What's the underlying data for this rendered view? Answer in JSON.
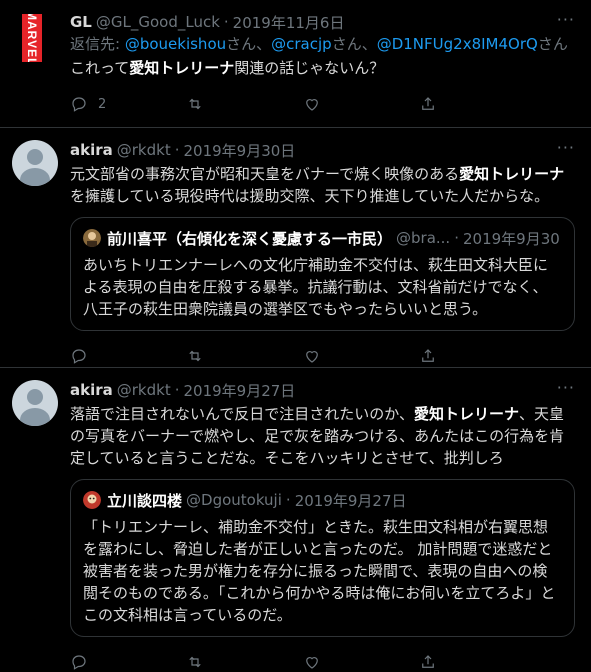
{
  "tweets": [
    {
      "name": "GL",
      "handle": "@GL_Good_Luck",
      "dot": "·",
      "date": "2019年11月6日",
      "avatar_text": "MARVEL",
      "replying_prefix": "返信先: ",
      "replying": [
        {
          "handle": "@bouekishou",
          "suffix": "さん、"
        },
        {
          "handle": "@cracjp",
          "suffix": "さん、"
        },
        {
          "handle": "@D1NFUg2x8IM4OrQ",
          "suffix": "さん"
        }
      ],
      "text_pre": "これって",
      "text_bold": "愛知トレリーナ",
      "text_post": "関連の話じゃないん？",
      "reply_count": "2",
      "more": "···"
    },
    {
      "name": "akira",
      "handle": "@rkdkt",
      "dot": "·",
      "date": "2019年9月30日",
      "text_pre": "元文部省の事務次官が昭和天皇をバナーで焼く映像のある",
      "text_bold": "愛知トレリーナ",
      "text_post": "を擁護している現役時代は援助交際、天下り推進していた人だからな。",
      "more": "···",
      "quote": {
        "name": "前川喜平（右傾化を深く憂慮する一市民）",
        "handle": "@bra...",
        "dot": "·",
        "date": "2019年9月30日",
        "text": "あいちトリエンナーレへの文化庁補助金不交付は、萩生田文科大臣による表現の自由を圧殺する暴挙。抗議行動は、文科省前だけでなく、八王子の萩生田衆院議員の選挙区でもやったらいいと思う。"
      }
    },
    {
      "name": "akira",
      "handle": "@rkdkt",
      "dot": "·",
      "date": "2019年9月27日",
      "text_pre": "落語で注目されないんで反日で注目されたいのか、",
      "text_bold": "愛知トレリーナ",
      "text_post": "、天皇の写真をバーナーで燃やし、足で灰を踏みつける、あんたはこの行為を肯定していると言うことだな。そこをハッキリとさせて、批判しろ",
      "more": "···",
      "quote": {
        "name": "立川談四楼",
        "handle": "@Dgoutokuji",
        "dot": "·",
        "date": "2019年9月27日",
        "text": "「トリエンナーレ、補助金不交付」ときた。萩生田文科相が右翼思想を露わにし、脅迫した者が正しいと言ったのだ。 加計問題で迷惑だと被害者を装った男が権力を存分に振るった瞬間で、表現の自由への検閲そのものである。「これから何かやる時は俺にお伺いを立てろよ」とこの文科相は言っているのだ。"
      }
    }
  ],
  "colors": {
    "background": "#000000",
    "text": "#d9d9d9",
    "muted": "#6e767d",
    "link": "#1d9bf0",
    "border": "#2f3336"
  }
}
